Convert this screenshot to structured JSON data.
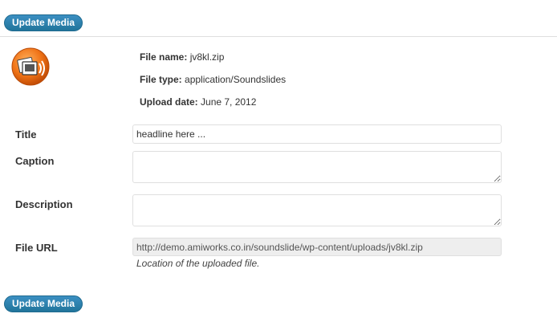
{
  "buttons": {
    "update_top": "Update Media",
    "update_bottom": "Update Media"
  },
  "file_info": {
    "icon": "soundslides-media-icon",
    "name_label": "File name:",
    "name_value": "jv8kl.zip",
    "type_label": "File type:",
    "type_value": "application/Soundslides",
    "date_label": "Upload date:",
    "date_value": "June 7, 2012"
  },
  "fields": {
    "title": {
      "label": "Title",
      "value": "headline here ..."
    },
    "caption": {
      "label": "Caption",
      "value": ""
    },
    "description": {
      "label": "Description",
      "value": ""
    },
    "file_url": {
      "label": "File URL",
      "value": "http://demo.amiworks.co.in/soundslide/wp-content/uploads/jv8kl.zip",
      "help": "Location of the uploaded file."
    }
  },
  "colors": {
    "button": "#21759b",
    "icon_orange": "#e8620a"
  }
}
